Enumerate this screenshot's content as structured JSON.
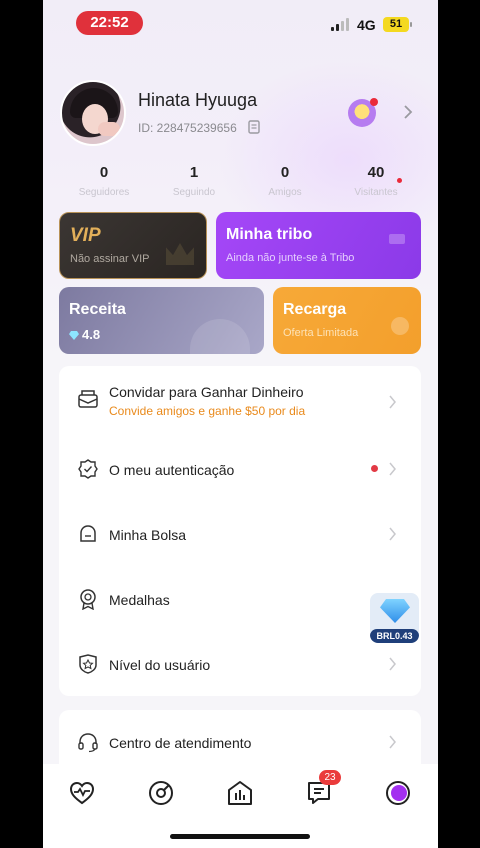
{
  "status_bar": {
    "time": "22:52",
    "network": "4G",
    "battery": "51"
  },
  "profile": {
    "name": "Hinata Hyuuga",
    "id_text": "ID: 228475239656"
  },
  "stats": [
    {
      "value": "0",
      "label": "Seguidores"
    },
    {
      "value": "1",
      "label": "Seguindo"
    },
    {
      "value": "0",
      "label": "Amigos"
    },
    {
      "value": "40",
      "label": "Visitantes"
    }
  ],
  "cards": {
    "vip": {
      "title": "VIP",
      "subtitle": "Não assinar VIP"
    },
    "tribo": {
      "title": "Minha tribo",
      "subtitle": "Ainda não junte-se à Tribo"
    },
    "receita": {
      "title": "Receita",
      "value": "4.8"
    },
    "recarga": {
      "title": "Recarga",
      "subtitle": "Oferta Limitada"
    }
  },
  "menu": [
    {
      "label": "Convidar para Ganhar Dinheiro",
      "desc": "Convide amigos e ganhe $50 por dia",
      "icon": "envelope-icon"
    },
    {
      "label": "O meu autenticação",
      "icon": "shield-check-icon"
    },
    {
      "label": "Minha Bolsa",
      "icon": "bag-icon"
    },
    {
      "label": "Medalhas",
      "icon": "medal-icon"
    },
    {
      "label": "Nível do usuário",
      "icon": "level-shield-icon"
    },
    {
      "label": "Centro de atendimento",
      "icon": "headset-icon"
    }
  ],
  "floating_badge": {
    "value": "BRL0.43"
  },
  "tabbar": {
    "items": [
      "heart-pulse-icon",
      "target-icon",
      "chart-house-icon",
      "message-icon",
      "avatar-icon"
    ],
    "messages_badge": "23"
  },
  "colors": {
    "accent_purple": "#9b41f3",
    "accent_orange": "#f5a232",
    "danger": "#e0313b"
  }
}
